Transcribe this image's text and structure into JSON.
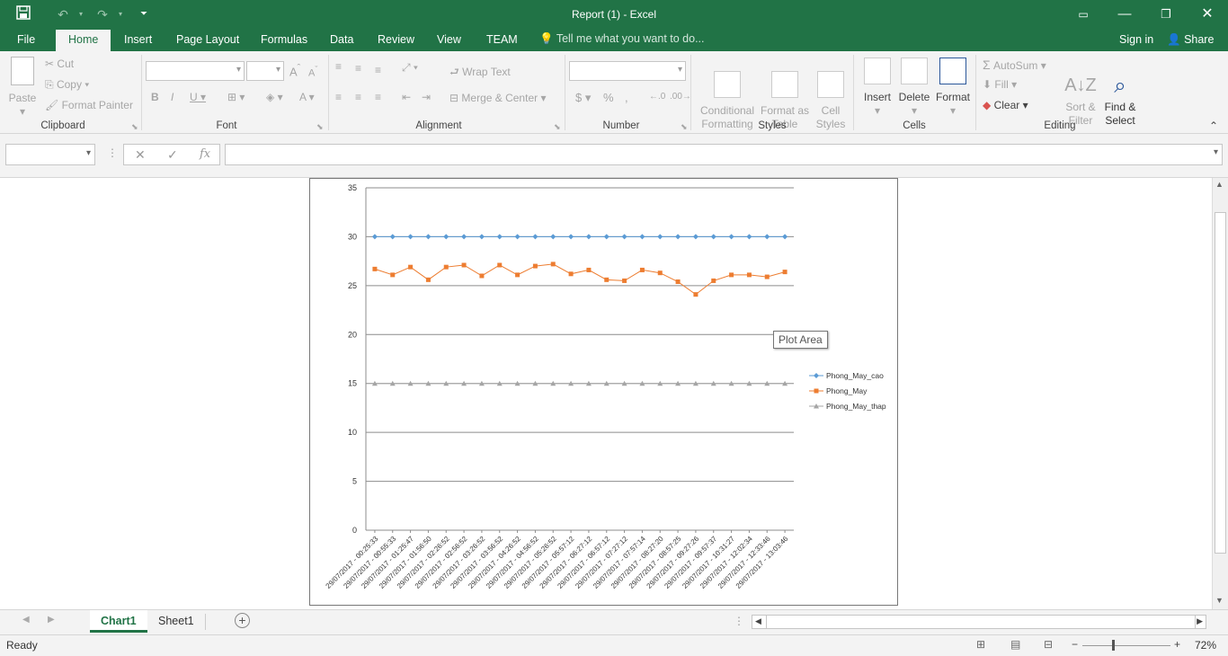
{
  "window": {
    "title": "Report (1) - Excel"
  },
  "tabs": [
    "File",
    "Home",
    "Insert",
    "Page Layout",
    "Formulas",
    "Data",
    "Review",
    "View",
    "TEAM"
  ],
  "tell_me": "Tell me what you want to do...",
  "account": {
    "sign_in": "Sign in",
    "share": "Share"
  },
  "ribbon": {
    "clipboard": {
      "paste": "Paste",
      "cut": "Cut",
      "copy": "Copy",
      "format_painter": "Format Painter",
      "label": "Clipboard"
    },
    "font": {
      "label": "Font"
    },
    "alignment": {
      "wrap_text": "Wrap Text",
      "merge_center": "Merge & Center",
      "label": "Alignment"
    },
    "number": {
      "label": "Number"
    },
    "styles": {
      "conditional_formatting": "Conditional\nFormatting",
      "format_as_table": "Format as\nTable",
      "cell_styles": "Cell\nStyles",
      "label": "Styles"
    },
    "cells": {
      "insert": "Insert",
      "delete": "Delete",
      "format": "Format",
      "label": "Cells"
    },
    "editing": {
      "autosum": "AutoSum",
      "fill": "Fill",
      "clear": "Clear",
      "sort_filter": "Sort &\nFilter",
      "find_select": "Find &\nSelect",
      "label": "Editing"
    }
  },
  "formula_bar": {
    "fx": "fx"
  },
  "tooltip": "Plot Area",
  "sheets": [
    "Chart1",
    "Sheet1"
  ],
  "status": {
    "ready": "Ready",
    "zoom": "72%"
  },
  "chart_data": {
    "type": "line",
    "categories": [
      "29/07/2017 - 00:25:33",
      "29/07/2017 - 00:55:33",
      "29/07/2017 - 01:25:47",
      "29/07/2017 - 01:56:50",
      "29/07/2017 - 02:26:52",
      "29/07/2017 - 02:56:52",
      "29/07/2017 - 03:26:52",
      "29/07/2017 - 03:56:52",
      "29/07/2017 - 04:26:52",
      "29/07/2017 - 04:56:52",
      "29/07/2017 - 05:26:52",
      "29/07/2017 - 05:57:12",
      "29/07/2017 - 06:27:12",
      "29/07/2017 - 06:57:12",
      "29/07/2017 - 07:27:12",
      "29/07/2017 - 07:57:14",
      "29/07/2017 - 08:27:20",
      "29/07/2017 - 08:57:25",
      "29/07/2017 - 09:27:26",
      "29/07/2017 - 09:57:37",
      "29/07/2017 - 10:31:27",
      "29/07/2017 - 12:02:34",
      "29/07/2017 - 12:33:46",
      "29/07/2017 - 13:03:46"
    ],
    "series": [
      {
        "name": "Phong_May_cao",
        "color": "#5b9bd5",
        "marker": "diamond",
        "values": [
          30,
          30,
          30,
          30,
          30,
          30,
          30,
          30,
          30,
          30,
          30,
          30,
          30,
          30,
          30,
          30,
          30,
          30,
          30,
          30,
          30,
          30,
          30,
          30
        ]
      },
      {
        "name": "Phong_May",
        "color": "#ed7d31",
        "marker": "square",
        "values": [
          26.7,
          26.1,
          26.9,
          25.6,
          26.9,
          27.1,
          26.0,
          27.1,
          26.1,
          27.0,
          27.2,
          26.2,
          26.6,
          25.6,
          25.5,
          26.6,
          26.3,
          25.4,
          24.1,
          25.5,
          26.1,
          26.1,
          25.9,
          26.4
        ]
      },
      {
        "name": "Phong_May_thap",
        "color": "#a5a5a5",
        "marker": "triangle",
        "values": [
          15,
          15,
          15,
          15,
          15,
          15,
          15,
          15,
          15,
          15,
          15,
          15,
          15,
          15,
          15,
          15,
          15,
          15,
          15,
          15,
          15,
          15,
          15,
          15
        ]
      }
    ],
    "yticks": [
      "0",
      "5",
      "10",
      "15",
      "20",
      "25",
      "30",
      "35"
    ],
    "ylim": [
      0,
      35
    ],
    "grid": true,
    "legend": "right"
  }
}
